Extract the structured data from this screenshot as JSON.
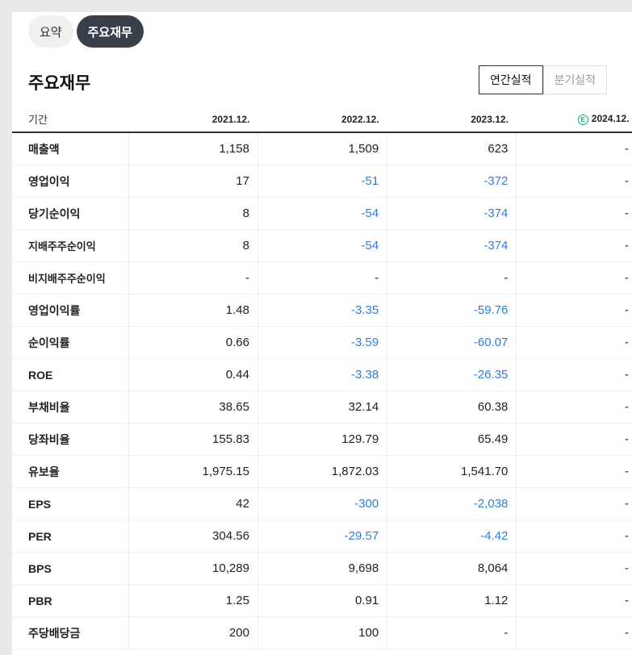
{
  "tabs": [
    {
      "label": "요약",
      "active": false
    },
    {
      "label": "주요재무",
      "active": true
    }
  ],
  "section_title": "주요재무",
  "period_toggle": {
    "annual": "연간실적",
    "quarterly": "분기실적",
    "selected": "annual"
  },
  "table": {
    "header_label": "기간",
    "columns": [
      "2021.12.",
      "2022.12.",
      "2023.12.",
      "2024.12."
    ],
    "estimate_marker": "E",
    "rows": [
      {
        "label": "매출액",
        "values": [
          "1,158",
          "1,509",
          "623",
          "-"
        ],
        "group_start": false
      },
      {
        "label": "영업이익",
        "values": [
          "17",
          "-51",
          "-372",
          "-"
        ],
        "group_start": false
      },
      {
        "label": "당기순이익",
        "values": [
          "8",
          "-54",
          "-374",
          "-"
        ],
        "group_start": false
      },
      {
        "label": "지배주주순이익",
        "values": [
          "8",
          "-54",
          "-374",
          "-"
        ],
        "group_start": false
      },
      {
        "label": "비지배주주순이익",
        "values": [
          "-",
          "-",
          "-",
          "-"
        ],
        "group_start": false
      },
      {
        "label": "영업이익률",
        "values": [
          "1.48",
          "-3.35",
          "-59.76",
          "-"
        ],
        "group_start": true
      },
      {
        "label": "순이익률",
        "values": [
          "0.66",
          "-3.59",
          "-60.07",
          "-"
        ],
        "group_start": false
      },
      {
        "label": "ROE",
        "values": [
          "0.44",
          "-3.38",
          "-26.35",
          "-"
        ],
        "group_start": false
      },
      {
        "label": "부채비율",
        "values": [
          "38.65",
          "32.14",
          "60.38",
          "-"
        ],
        "group_start": true
      },
      {
        "label": "당좌비율",
        "values": [
          "155.83",
          "129.79",
          "65.49",
          "-"
        ],
        "group_start": false
      },
      {
        "label": "유보율",
        "values": [
          "1,975.15",
          "1,872.03",
          "1,541.70",
          "-"
        ],
        "group_start": false
      },
      {
        "label": "EPS",
        "values": [
          "42",
          "-300",
          "-2,038",
          "-"
        ],
        "group_start": true
      },
      {
        "label": "PER",
        "values": [
          "304.56",
          "-29.57",
          "-4.42",
          "-"
        ],
        "group_start": false
      },
      {
        "label": "BPS",
        "values": [
          "10,289",
          "9,698",
          "8,064",
          "-"
        ],
        "group_start": false
      },
      {
        "label": "PBR",
        "values": [
          "1.25",
          "0.91",
          "1.12",
          "-"
        ],
        "group_start": false
      },
      {
        "label": "주당배당금",
        "values": [
          "200",
          "100",
          "-",
          "-"
        ],
        "group_start": true
      }
    ]
  },
  "colors": {
    "negative": "#2f7ddb",
    "active_pill": "#3a4049"
  }
}
